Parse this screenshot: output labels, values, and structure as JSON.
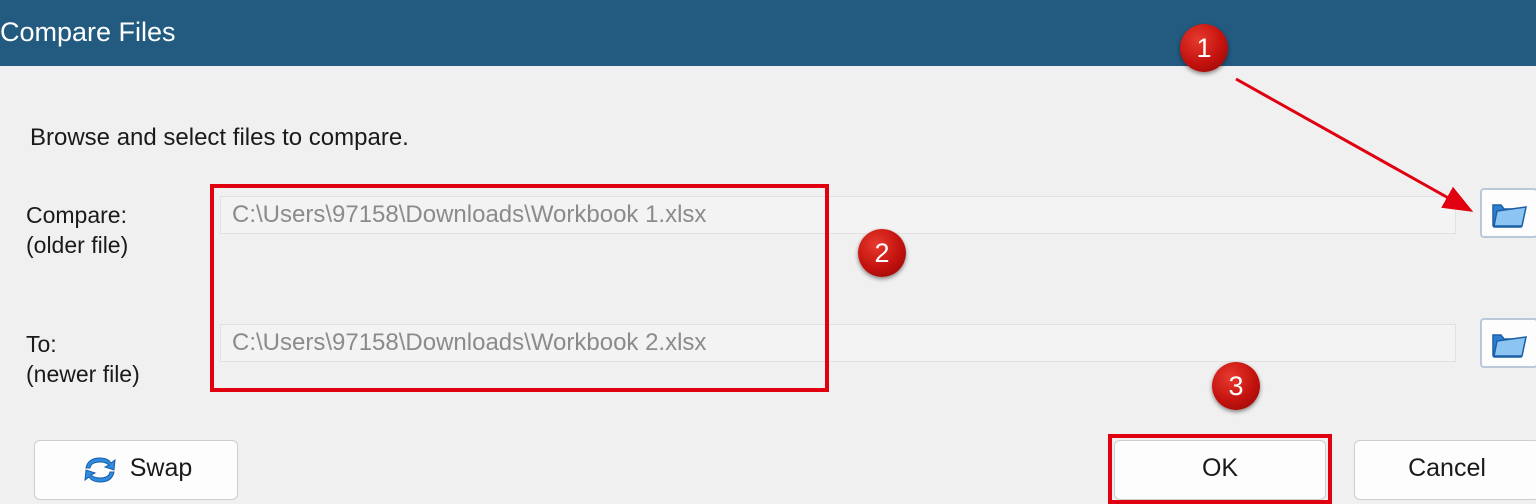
{
  "window": {
    "title": "Compare Files"
  },
  "instruction": "Browse and select files to compare.",
  "compare": {
    "label": "Compare:",
    "sublabel": "(older file)",
    "path": "C:\\Users\\97158\\Downloads\\Workbook 1.xlsx"
  },
  "to": {
    "label": "To:",
    "sublabel": "(newer file)",
    "path": "C:\\Users\\97158\\Downloads\\Workbook 2.xlsx"
  },
  "buttons": {
    "swap": "Swap",
    "ok": "OK",
    "cancel": "Cancel"
  },
  "annotations": {
    "badge1": "1",
    "badge2": "2",
    "badge3": "3",
    "color": "#e0000f"
  },
  "icons": {
    "browse": "folder-icon",
    "swap": "swap-arrows-icon"
  }
}
